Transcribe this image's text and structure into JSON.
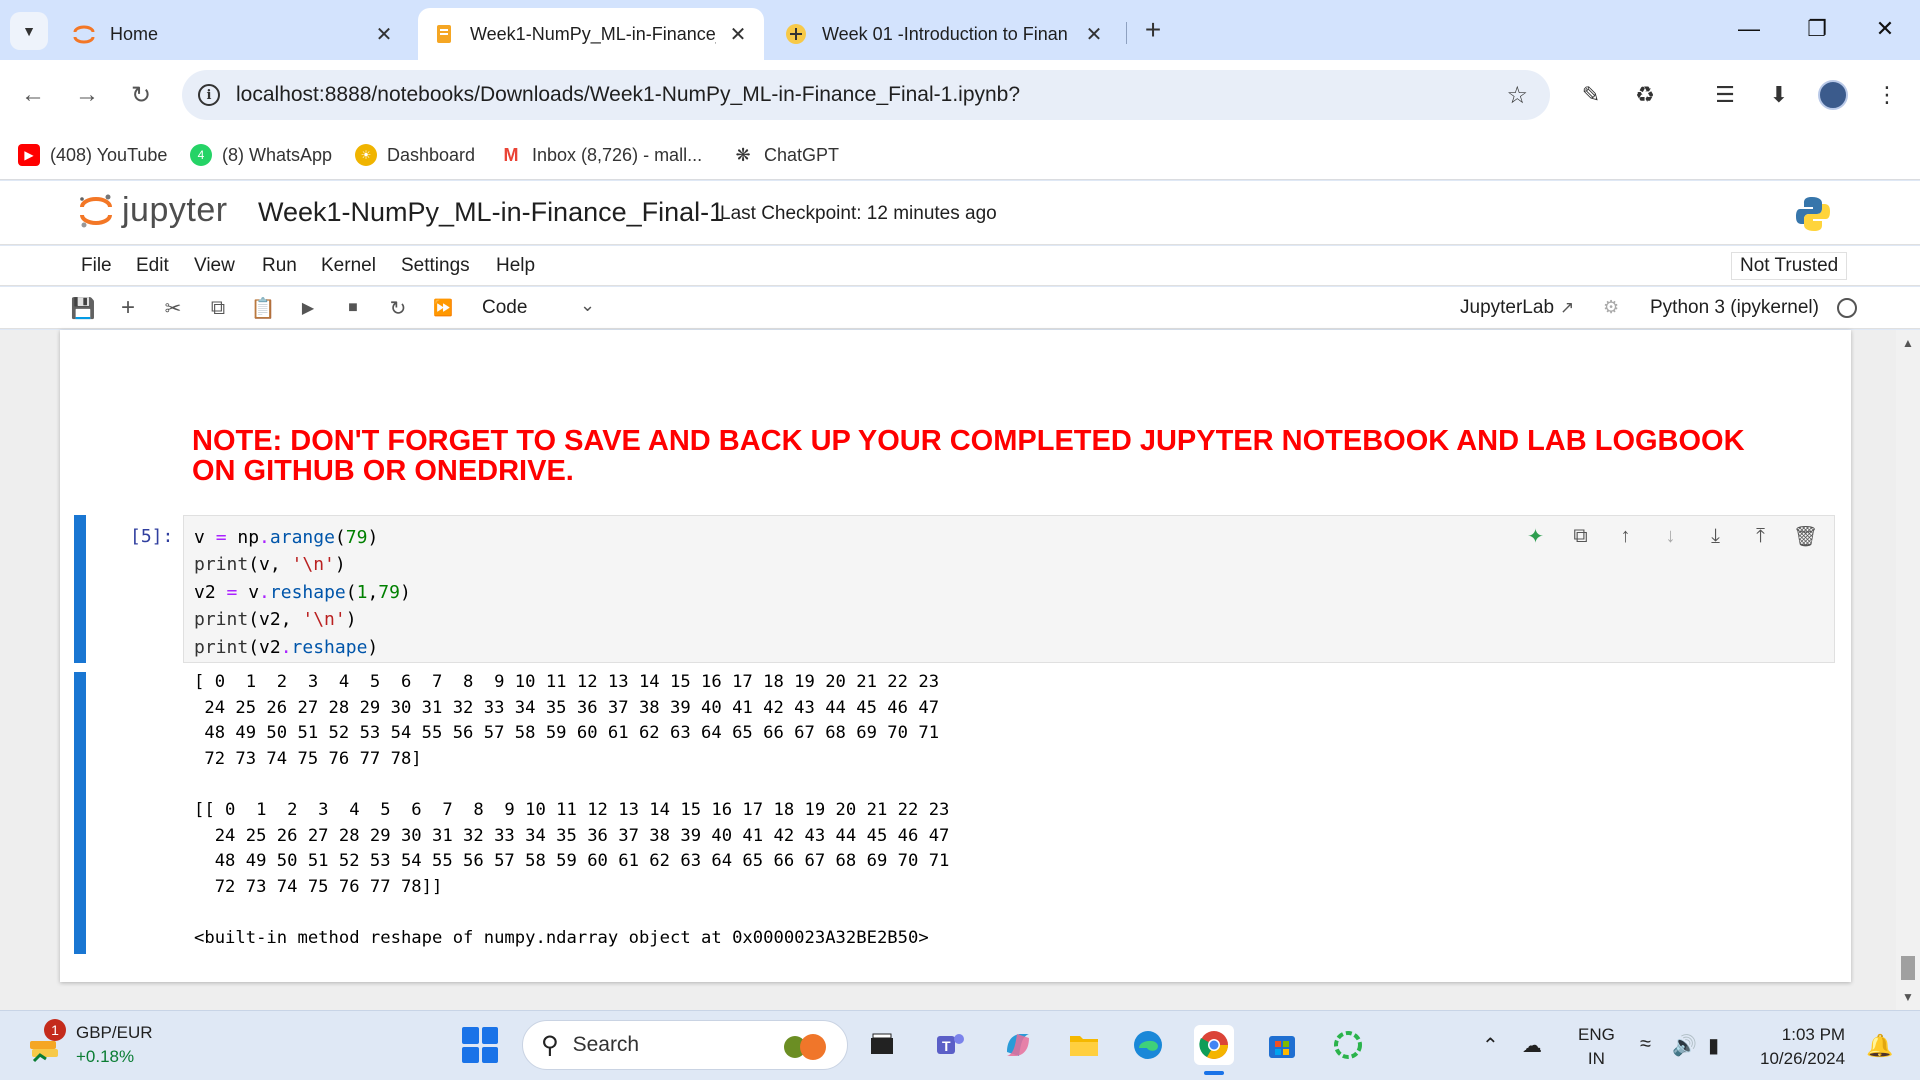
{
  "browser": {
    "tab_search_icon": "chevron-down-icon",
    "tabs": [
      {
        "title": "Home",
        "icon": "jupyter-icon"
      },
      {
        "title": "Week1-NumPy_ML-in-Finance_",
        "icon": "notebook-icon",
        "active": true
      },
      {
        "title": "Week 01 -Introduction to Finan",
        "icon": "course-icon"
      }
    ],
    "url": "localhost:8888/notebooks/Downloads/Week1-NumPy_ML-in-Finance_Final-1.ipynb?",
    "bookmarks": [
      {
        "label": "(408) YouTube",
        "icon": "youtube-icon",
        "color": "#ff0000"
      },
      {
        "label": "(8) WhatsApp",
        "icon": "whatsapp-icon",
        "color": "#25d366"
      },
      {
        "label": "Dashboard",
        "icon": "dashboard-icon",
        "color": "#f0b400"
      },
      {
        "label": "Inbox (8,726) - mall...",
        "icon": "gmail-icon",
        "color": "#ea4335"
      },
      {
        "label": "ChatGPT",
        "icon": "chatgpt-icon",
        "color": "#333333"
      }
    ]
  },
  "jupyter": {
    "logo_text": "jupyter",
    "notebook_name": "Week1-NumPy_ML-in-Finance_Final-1",
    "checkpoint": "Last Checkpoint: 12 minutes ago",
    "menu": [
      "File",
      "Edit",
      "View",
      "Run",
      "Kernel",
      "Settings",
      "Help"
    ],
    "trust": "Not Trusted",
    "cell_type": "Code",
    "jupyterlab_link": "JupyterLab",
    "kernel": "Python 3 (ipykernel)"
  },
  "notebook": {
    "note": "NOTE: DON'T FORGET TO SAVE AND BACK UP YOUR COMPLETED JUPYTER NOTEBOOK AND LAB LOGBOOK ON GITHUB OR ONEDRIVE.",
    "prompt": "[5]:",
    "code_lines": [
      "v = np.arange(79)",
      "print(v, '\\n')",
      "v2 = v.reshape(1,79)",
      "print(v2, '\\n')",
      "print(v2.reshape)"
    ],
    "output_lines": [
      "[ 0  1  2  3  4  5  6  7  8  9 10 11 12 13 14 15 16 17 18 19 20 21 22 23",
      " 24 25 26 27 28 29 30 31 32 33 34 35 36 37 38 39 40 41 42 43 44 45 46 47",
      " 48 49 50 51 52 53 54 55 56 57 58 59 60 61 62 63 64 65 66 67 68 69 70 71",
      " 72 73 74 75 76 77 78]",
      "",
      "[[ 0  1  2  3  4  5  6  7  8  9 10 11 12 13 14 15 16 17 18 19 20 21 22 23",
      "  24 25 26 27 28 29 30 31 32 33 34 35 36 37 38 39 40 41 42 43 44 45 46 47",
      "  48 49 50 51 52 53 54 55 56 57 58 59 60 61 62 63 64 65 66 67 68 69 70 71",
      "  72 73 74 75 76 77 78]]",
      "",
      "<built-in method reshape of numpy.ndarray object at 0x0000023A32BE2B50>"
    ],
    "note_color": "#ff0000",
    "active_cell_color": "#1976d2"
  },
  "taskbar": {
    "widget_badge": "1",
    "widget_title": "GBP/EUR",
    "widget_change": "+0.18%",
    "search_label": "Search",
    "lang_top": "ENG",
    "lang_bottom": "IN",
    "time": "1:03 PM",
    "date": "10/26/2024",
    "apps": [
      "file-explorer-icon",
      "teams-icon",
      "copilot-icon",
      "folder-icon",
      "edge-icon",
      "chrome-icon",
      "store-icon",
      "loading-icon"
    ]
  }
}
